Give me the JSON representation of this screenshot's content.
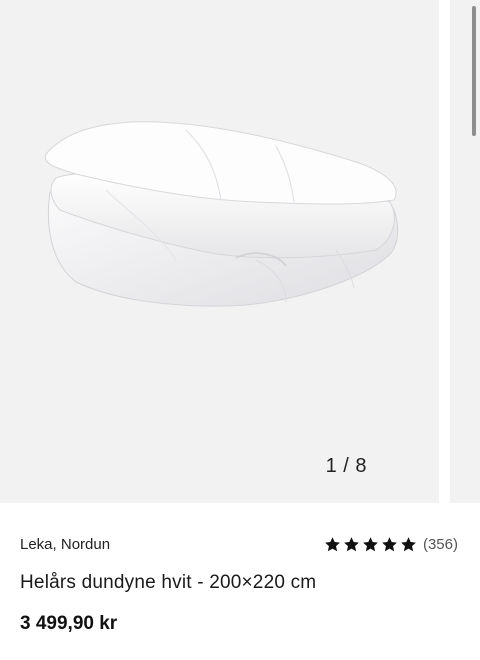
{
  "gallery": {
    "counter": "1 / 8",
    "image_icon": "duvet-image"
  },
  "product": {
    "vendor": "Leka, Nordun",
    "rating_stars": 5,
    "rating_count": "(356)",
    "title": "Helårs dundyne hvit - 200×220 cm",
    "price": "3 499,90 kr"
  }
}
